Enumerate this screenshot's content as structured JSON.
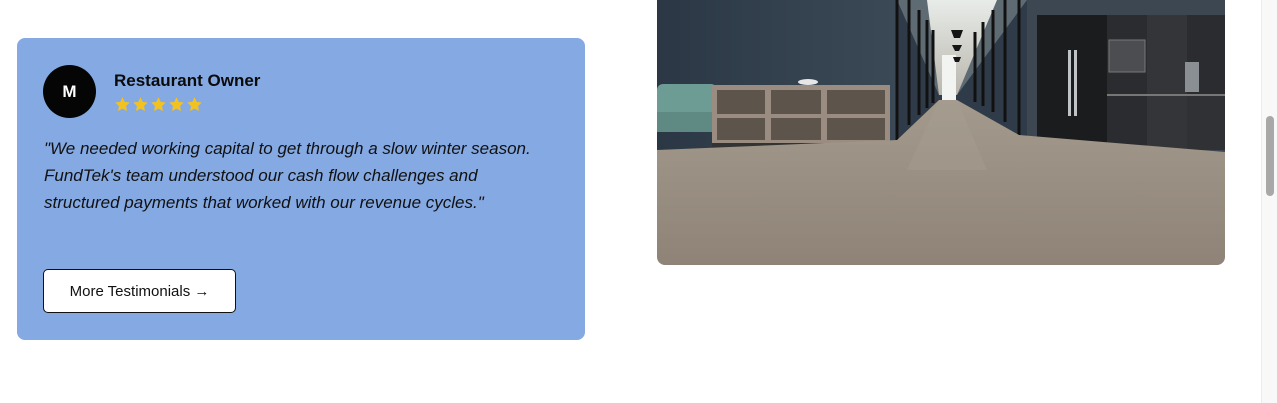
{
  "testimonial": {
    "avatar_initial": "M",
    "author": "Restaurant Owner",
    "rating": 5,
    "rating_max": 5,
    "quote": "\"We needed working capital to get through a slow winter season. FundTek's team understood our cash flow challenges and structured payments that worked with our revenue cycles.\"",
    "button_label": "More Testimonials →"
  },
  "colors": {
    "card_background": "#84a9e3",
    "avatar_background": "#050505",
    "star": "#f4c21f"
  },
  "photo": {
    "subject": "modern office interior with long glass-walled corridor"
  },
  "scrollbar": {
    "position_fraction": 0.29
  }
}
